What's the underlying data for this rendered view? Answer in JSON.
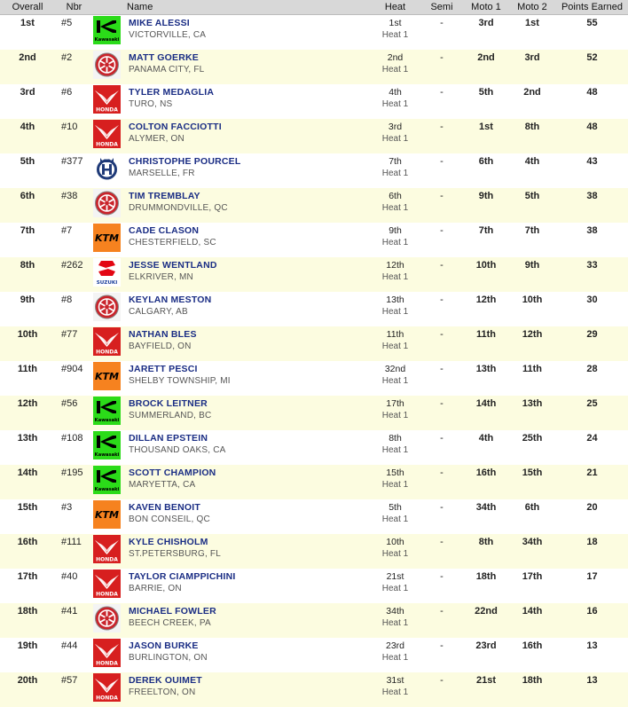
{
  "headers": {
    "overall": "Overall",
    "nbr": "Nbr",
    "name": "Name",
    "heat": "Heat",
    "semi": "Semi",
    "moto1": "Moto 1",
    "moto2": "Moto 2",
    "points": "Points Earned"
  },
  "brand_labels": {
    "kawasaki": "Kawasaki",
    "honda": "HONDA",
    "ktm": "KTM",
    "suzuki": "SUZUKI"
  },
  "rows": [
    {
      "overall": "1st",
      "nbr": "#5",
      "brand": "kawasaki",
      "name": "MIKE ALESSI",
      "location": "VICTORVILLE, CA",
      "heat": "1st",
      "heat_label": "Heat 1",
      "semi": "-",
      "moto1": "3rd",
      "moto2": "1st",
      "points": "55"
    },
    {
      "overall": "2nd",
      "nbr": "#2",
      "brand": "yamaha",
      "name": "MATT GOERKE",
      "location": "PANAMA CITY, FL",
      "heat": "2nd",
      "heat_label": "Heat 1",
      "semi": "-",
      "moto1": "2nd",
      "moto2": "3rd",
      "points": "52"
    },
    {
      "overall": "3rd",
      "nbr": "#6",
      "brand": "honda",
      "name": "TYLER MEDAGLIA",
      "location": "TURO, NS",
      "heat": "4th",
      "heat_label": "Heat 1",
      "semi": "-",
      "moto1": "5th",
      "moto2": "2nd",
      "points": "48"
    },
    {
      "overall": "4th",
      "nbr": "#10",
      "brand": "honda",
      "name": "COLTON FACCIOTTI",
      "location": "ALYMER, ON",
      "heat": "3rd",
      "heat_label": "Heat 1",
      "semi": "-",
      "moto1": "1st",
      "moto2": "8th",
      "points": "48"
    },
    {
      "overall": "5th",
      "nbr": "#377",
      "brand": "husqvarna",
      "name": "CHRISTOPHE POURCEL",
      "location": "MARSELLE, FR",
      "heat": "7th",
      "heat_label": "Heat 1",
      "semi": "-",
      "moto1": "6th",
      "moto2": "4th",
      "points": "43"
    },
    {
      "overall": "6th",
      "nbr": "#38",
      "brand": "yamaha",
      "name": "TIM TREMBLAY",
      "location": "DRUMMONDVILLE, QC",
      "heat": "6th",
      "heat_label": "Heat 1",
      "semi": "-",
      "moto1": "9th",
      "moto2": "5th",
      "points": "38"
    },
    {
      "overall": "7th",
      "nbr": "#7",
      "brand": "ktm",
      "name": "CADE CLASON",
      "location": "CHESTERFIELD, SC",
      "heat": "9th",
      "heat_label": "Heat 1",
      "semi": "-",
      "moto1": "7th",
      "moto2": "7th",
      "points": "38"
    },
    {
      "overall": "8th",
      "nbr": "#262",
      "brand": "suzuki",
      "name": "JESSE WENTLAND",
      "location": "ELKRIVER, MN",
      "heat": "12th",
      "heat_label": "Heat 1",
      "semi": "-",
      "moto1": "10th",
      "moto2": "9th",
      "points": "33"
    },
    {
      "overall": "9th",
      "nbr": "#8",
      "brand": "yamaha",
      "name": "KEYLAN MESTON",
      "location": "CALGARY, AB",
      "heat": "13th",
      "heat_label": "Heat 1",
      "semi": "-",
      "moto1": "12th",
      "moto2": "10th",
      "points": "30"
    },
    {
      "overall": "10th",
      "nbr": "#77",
      "brand": "honda",
      "name": "NATHAN BLES",
      "location": "BAYFIELD, ON",
      "heat": "11th",
      "heat_label": "Heat 1",
      "semi": "-",
      "moto1": "11th",
      "moto2": "12th",
      "points": "29"
    },
    {
      "overall": "11th",
      "nbr": "#904",
      "brand": "ktm",
      "name": "JARETT PESCI",
      "location": "SHELBY TOWNSHIP, MI",
      "heat": "32nd",
      "heat_label": "Heat 1",
      "semi": "-",
      "moto1": "13th",
      "moto2": "11th",
      "points": "28"
    },
    {
      "overall": "12th",
      "nbr": "#56",
      "brand": "kawasaki",
      "name": "BROCK LEITNER",
      "location": "SUMMERLAND, BC",
      "heat": "17th",
      "heat_label": "Heat 1",
      "semi": "-",
      "moto1": "14th",
      "moto2": "13th",
      "points": "25"
    },
    {
      "overall": "13th",
      "nbr": "#108",
      "brand": "kawasaki",
      "name": "DILLAN EPSTEIN",
      "location": "THOUSAND OAKS, CA",
      "heat": "8th",
      "heat_label": "Heat 1",
      "semi": "-",
      "moto1": "4th",
      "moto2": "25th",
      "points": "24"
    },
    {
      "overall": "14th",
      "nbr": "#195",
      "brand": "kawasaki",
      "name": "SCOTT CHAMPION",
      "location": "MARYETTA, CA",
      "heat": "15th",
      "heat_label": "Heat 1",
      "semi": "-",
      "moto1": "16th",
      "moto2": "15th",
      "points": "21"
    },
    {
      "overall": "15th",
      "nbr": "#3",
      "brand": "ktm",
      "name": "KAVEN BENOIT",
      "location": "BON CONSEIL, QC",
      "heat": "5th",
      "heat_label": "Heat 1",
      "semi": "-",
      "moto1": "34th",
      "moto2": "6th",
      "points": "20"
    },
    {
      "overall": "16th",
      "nbr": "#111",
      "brand": "honda",
      "name": "KYLE CHISHOLM",
      "location": "ST.PETERSBURG, FL",
      "heat": "10th",
      "heat_label": "Heat 1",
      "semi": "-",
      "moto1": "8th",
      "moto2": "34th",
      "points": "18"
    },
    {
      "overall": "17th",
      "nbr": "#40",
      "brand": "honda",
      "name": "TAYLOR CIAMPPICHINI",
      "location": "BARRIE, ON",
      "heat": "21st",
      "heat_label": "Heat 1",
      "semi": "-",
      "moto1": "18th",
      "moto2": "17th",
      "points": "17"
    },
    {
      "overall": "18th",
      "nbr": "#41",
      "brand": "yamaha",
      "name": "MICHAEL FOWLER",
      "location": "BEECH CREEK, PA",
      "heat": "34th",
      "heat_label": "Heat 1",
      "semi": "-",
      "moto1": "22nd",
      "moto2": "14th",
      "points": "16"
    },
    {
      "overall": "19th",
      "nbr": "#44",
      "brand": "honda",
      "name": "JASON BURKE",
      "location": "BURLINGTON, ON",
      "heat": "23rd",
      "heat_label": "Heat 1",
      "semi": "-",
      "moto1": "23rd",
      "moto2": "16th",
      "points": "13"
    },
    {
      "overall": "20th",
      "nbr": "#57",
      "brand": "honda",
      "name": "DEREK OUIMET",
      "location": "FREELTON, ON",
      "heat": "31st",
      "heat_label": "Heat 1",
      "semi": "-",
      "moto1": "21st",
      "moto2": "18th",
      "points": "13"
    }
  ]
}
